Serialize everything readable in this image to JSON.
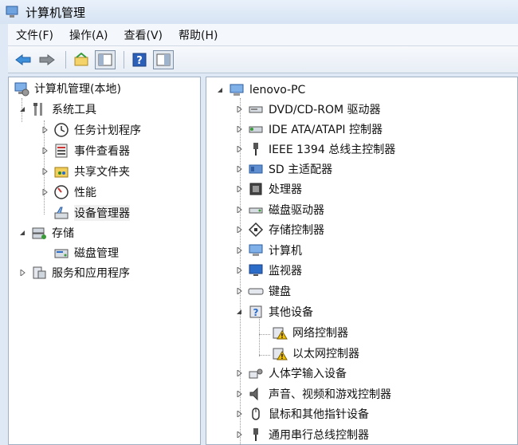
{
  "window": {
    "title": "计算机管理"
  },
  "menu": [
    {
      "id": "file",
      "label": "文件(F)"
    },
    {
      "id": "action",
      "label": "操作(A)"
    },
    {
      "id": "view",
      "label": "查看(V)"
    },
    {
      "id": "help",
      "label": "帮助(H)"
    }
  ],
  "toolbar": [
    {
      "id": "back",
      "icon": "back-arrow-icon"
    },
    {
      "id": "forward",
      "icon": "forward-arrow-icon"
    },
    {
      "id": "up",
      "icon": "up-folder-icon"
    },
    {
      "id": "showhide",
      "icon": "show-hide-tree-icon"
    },
    {
      "id": "help",
      "icon": "help-icon"
    },
    {
      "id": "console",
      "icon": "console-icon"
    }
  ],
  "left_tree": {
    "root": "计算机管理(本地)",
    "system_tools": "系统工具",
    "task_scheduler": "任务计划程序",
    "event_viewer": "事件查看器",
    "shared_folders": "共享文件夹",
    "performance": "性能",
    "device_manager": "设备管理器",
    "storage": "存储",
    "disk_management": "磁盘管理",
    "services_apps": "服务和应用程序"
  },
  "right_tree": {
    "root": "lenovo-PC",
    "dvd": "DVD/CD-ROM 驱动器",
    "ide": "IDE ATA/ATAPI 控制器",
    "ieee": "IEEE 1394 总线主控制器",
    "sd": "SD 主适配器",
    "cpu": "处理器",
    "disk": "磁盘驱动器",
    "storage": "存储控制器",
    "computer": "计算机",
    "monitor": "监视器",
    "keyboard": "键盘",
    "other": "其他设备",
    "network": "网络控制器",
    "ethernet": "以太网控制器",
    "hid": "人体学输入设备",
    "sound": "声音、视频和游戏控制器",
    "mouse": "鼠标和其他指针设备",
    "usb": "通用串行总线控制器"
  },
  "colors": {
    "accent": "#2a6cc8",
    "warning": "#f2c200",
    "pane_border": "#9fb0c4"
  }
}
